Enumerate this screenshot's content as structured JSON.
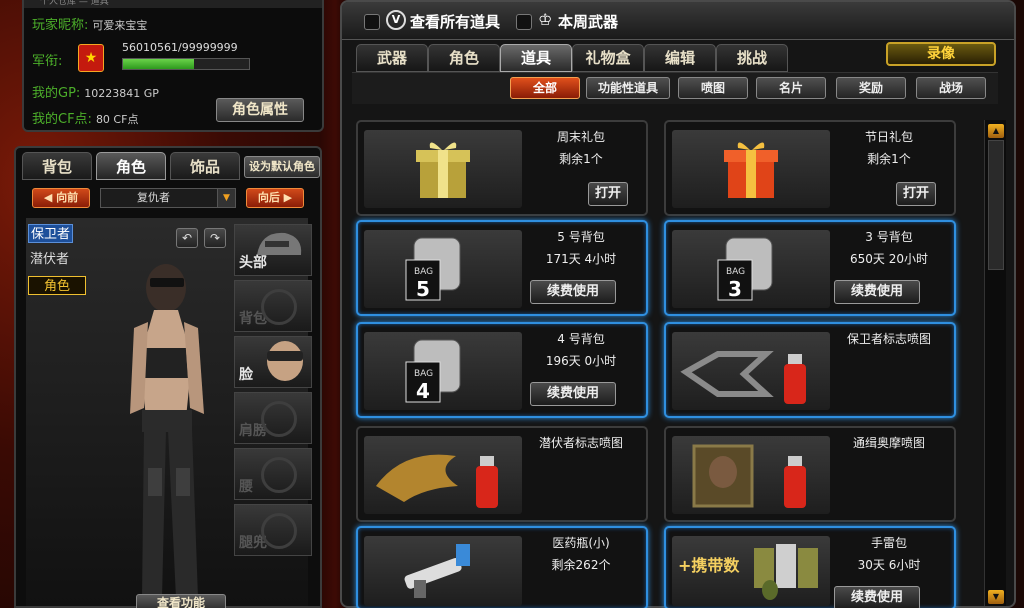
{
  "player": {
    "top_text": "个人仓库 — 道具",
    "nickname_label": "玩家昵称:",
    "nickname_value": "可爱来宝宝",
    "rank_label": "军衔:",
    "xp_text": "56010561/99999999",
    "xp_fraction": 0.56,
    "gp_label": "我的GP:",
    "gp_value": "10223841 GP",
    "cf_label": "我的CF点:",
    "cf_value": "80 CF点",
    "role_attr_button": "角色属性"
  },
  "left_tabs": [
    "背包",
    "角色",
    "饰品"
  ],
  "set_default_role": "设为默认角色",
  "role_nav": {
    "prev": "向前",
    "current": "复仇者",
    "next": "向后"
  },
  "factions": [
    "保卫者",
    "潜伏者",
    "角色"
  ],
  "equip_slots": [
    "头部",
    "背包",
    "脸",
    "肩膀",
    "腰",
    "腿兜"
  ],
  "view_function_button": "查看功能",
  "header": {
    "view_all_label": "查看所有道具",
    "weekly_weapon_label": "本周武器"
  },
  "main_tabs": [
    "武器",
    "角色",
    "道具",
    "礼物盒",
    "编辑",
    "挑战"
  ],
  "record_button": "录像",
  "sub_tabs": [
    "全部",
    "功能性道具",
    "喷图",
    "名片",
    "奖励",
    "战场"
  ],
  "items": [
    {
      "name": "周末礼包",
      "sub": "剩余1个",
      "action": "打开"
    },
    {
      "name": "节日礼包",
      "sub": "剩余1个",
      "action": "打开"
    },
    {
      "name": "5 号背包",
      "sub": "171天 4小时",
      "action": "续费使用",
      "bag_number": "5"
    },
    {
      "name": "3 号背包",
      "sub": "650天 20小时",
      "action": "续费使用",
      "bag_number": "3"
    },
    {
      "name": "4 号背包",
      "sub": "196天 0小时",
      "action": "续费使用",
      "bag_number": "4"
    },
    {
      "name": "保卫者标志喷图",
      "sub": "",
      "action": ""
    },
    {
      "name": "潜伏者标志喷图",
      "sub": "",
      "action": ""
    },
    {
      "name": "通缉奥摩喷图",
      "sub": "",
      "action": ""
    },
    {
      "name": "医药瓶(小)",
      "sub": "剩余262个",
      "action": ""
    },
    {
      "name": "手雷包",
      "sub": "30天 6小时",
      "action": "续费使用",
      "badge": "+携带数"
    }
  ],
  "spray_label": "BAG",
  "colors": {
    "accent_blue": "#2f8fe0",
    "accent_orange": "#e0501c",
    "gold": "#ffd23a",
    "green": "#4caf2a"
  }
}
